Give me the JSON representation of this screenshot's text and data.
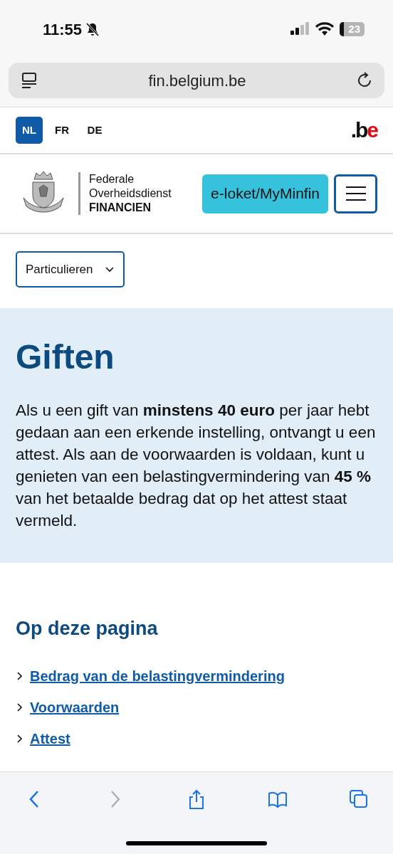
{
  "status_bar": {
    "time": "11:55",
    "battery": "23"
  },
  "address_bar": {
    "url": "fin.belgium.be"
  },
  "languages": [
    {
      "label": "NL",
      "selected": true
    },
    {
      "label": "FR",
      "selected": false
    },
    {
      "label": "DE",
      "selected": false
    }
  ],
  "portal_logo": {
    "text": ".be"
  },
  "header": {
    "org_lines": [
      "Federale",
      "Overheidsdienst"
    ],
    "org_name": "FINANCIEN",
    "login_button": "e-loket/MyMinfin"
  },
  "audience_dropdown": {
    "label": "Particulieren"
  },
  "hero": {
    "title": "Giften",
    "text": "Als u een gift van **minstens 40 euro** per jaar hebt gedaan aan een erkende instelling, ontvangt u een attest. Als aan de voorwaarden is voldaan, kunt u genieten van een belastingvermindering van **45 %** van het betaalde bedrag dat op het attest staat vermeld."
  },
  "on_this_page": {
    "title": "Op deze pagina",
    "links": [
      "Bedrag van de belastingvermindering",
      "Voorwaarden",
      "Attest"
    ]
  },
  "toolbar": [
    {
      "kind": "back",
      "disabled": false
    },
    {
      "kind": "forward",
      "disabled": true
    },
    {
      "kind": "share",
      "disabled": false
    },
    {
      "kind": "bookmarks",
      "disabled": false
    },
    {
      "kind": "tabs",
      "disabled": false
    }
  ]
}
